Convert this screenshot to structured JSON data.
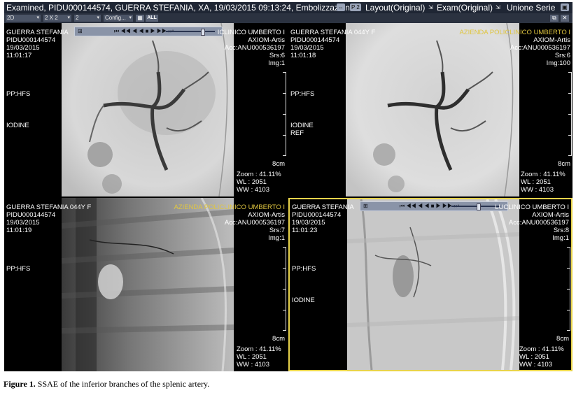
{
  "titlebar": {
    "title": "Examined, PIDU000144574, GUERRA STEFANIA, XA, 19/03/2015 09:13:24, Embolizzazion",
    "badge": "P 2",
    "layout_menu": "Layout(Original)",
    "exam_menu": "Exam(Original)",
    "series_menu": "Unione Serie"
  },
  "toolbar": {
    "mode_select": "2D",
    "grid_select": "2 X 2",
    "count_select": "2",
    "config_select": "Config..."
  },
  "viewport_tools": {
    "all_label": "ALL",
    "player_glyphs": "⏮ ◀◀ ◀ ◀ ■ ▶ ▶▶ ⏭"
  },
  "viewports": [
    {
      "patient": "GUERRA STEFANIA",
      "patient_suffix": "",
      "pid": "PIDU000144574",
      "date": "19/03/2015",
      "time": "11:01:17",
      "position": "PP:HFS",
      "contrast": "IODINE",
      "ref": "",
      "institution": "ICLINICO UMBERTO I",
      "device": "AXIOM-Artis",
      "acc": "Acc:ANU000536197",
      "series": "Srs:6",
      "image": "Img:1",
      "scale": "8cm",
      "zoom": "Zoom : 41.11%",
      "wl": "WL : 2051",
      "ww": "WW : 4103"
    },
    {
      "patient": "GUERRA STEFANIA",
      "patient_suffix": "044Y F",
      "pid": "PIDU000144574",
      "date": "19/03/2015",
      "time": "11:01:18",
      "position": "PP:HFS",
      "contrast": "IODINE",
      "ref": "REF",
      "institution": "AZIENDA POLICLINICO UMBERTO I",
      "device": "AXIOM-Artis",
      "acc": "Acc:ANU000536197",
      "series": "Srs:6",
      "image": "Img:100",
      "scale": "8cm",
      "zoom": "Zoom : 41.11%",
      "wl": "WL : 2051",
      "ww": "WW : 4103"
    },
    {
      "patient": "GUERRA STEFANIA",
      "patient_suffix": "044Y F",
      "pid": "PIDU000144574",
      "date": "19/03/2015",
      "time": "11:01:19",
      "position": "PP:HFS",
      "contrast": "",
      "ref": "",
      "institution": "AZIENDA POLICLINICO UMBERTO I",
      "device": "AXIOM-Artis",
      "acc": "Acc:ANU000536197",
      "series": "Srs:7",
      "image": "Img:1",
      "scale": "8cm",
      "zoom": "Zoom : 41.11%",
      "wl": "WL : 2051",
      "ww": "WW : 4103"
    },
    {
      "patient": "GUERRA STEFANIA",
      "patient_suffix": "",
      "pid": "PIDU000144574",
      "date": "19/03/2015",
      "time": "11:01:23",
      "position": "PP:HFS",
      "contrast": "IODINE",
      "ref": "",
      "institution": "LUCLINICO UMBERTO I",
      "device": "AXIOM-Artis",
      "acc": "Acc:ANU000536197",
      "series": "Srs:8",
      "image": "Img:1",
      "scale": "8cm",
      "zoom": "Zoom : 41.11%",
      "wl": "WL : 2051",
      "ww": "WW : 4103"
    }
  ],
  "caption": {
    "label": "Figure 1.",
    "text": " SSAE of the inferior branches of the splenic artery."
  },
  "colors": {
    "active_viewport_border": "#e8d34a",
    "overlay_text": "#ffffff",
    "institution_text": "#e0c640",
    "titlebar_bg": "#1f2634"
  }
}
